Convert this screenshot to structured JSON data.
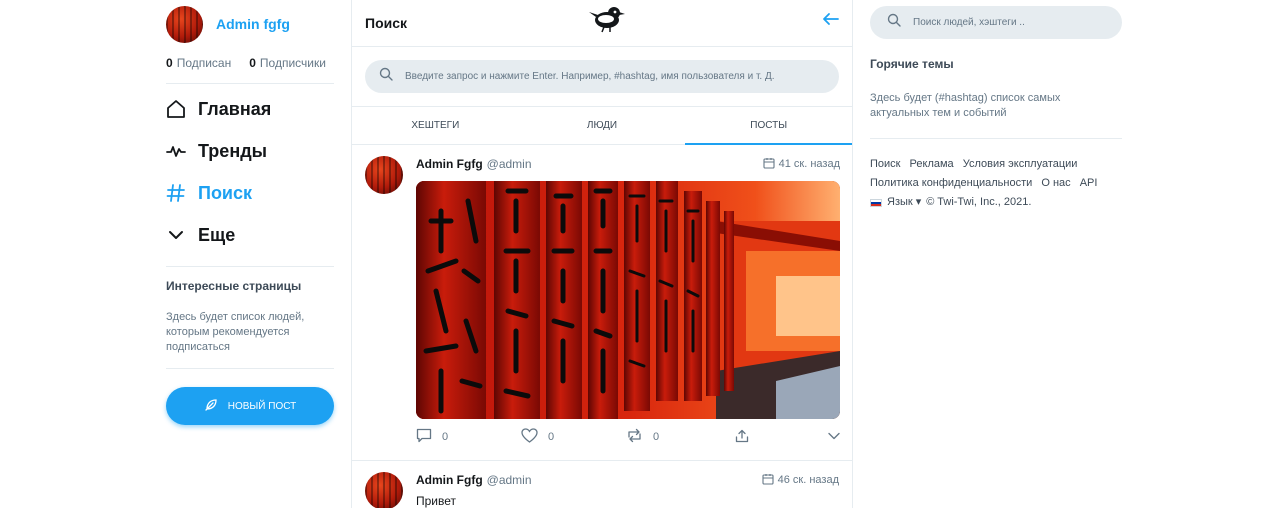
{
  "user": {
    "name": "Admin fgfg",
    "following_count": "0",
    "following_label": "Подписан",
    "followers_count": "0",
    "followers_label": "Подписчики"
  },
  "nav": [
    {
      "label": "Главная",
      "icon": "home-icon"
    },
    {
      "label": "Тренды",
      "icon": "activity-icon"
    },
    {
      "label": "Поиск",
      "icon": "hashtag-icon"
    },
    {
      "label": "Еще",
      "icon": "chevron-down-icon"
    }
  ],
  "interesting": {
    "title": "Интересные страницы",
    "text": "Здесь будет список людей, которым рекомендуется подписаться"
  },
  "new_post_label": "Новый пост",
  "main": {
    "title": "Поиск",
    "search_placeholder": "Введите запрос и нажмите Enter. Например, #hashtag, имя пользователя и т. Д.",
    "tabs": [
      "Хештеги",
      "Люди",
      "Посты"
    ],
    "active_tab": 2
  },
  "posts": [
    {
      "author": "Admin Fgfg",
      "handle": "@admin",
      "time": "41 ск. назад",
      "comments": "0",
      "likes": "0",
      "reposts": "0"
    },
    {
      "author": "Admin Fgfg",
      "handle": "@admin",
      "time": "46 ск. назад",
      "text": "Привет"
    }
  ],
  "right": {
    "search_placeholder": "Поиск людей, хэштеги ..",
    "hot_title": "Горячие темы",
    "hot_text": "Здесь будет (#hashtag) список самых актуальных тем и событий",
    "footer_links": [
      "Поиск",
      "Реклама",
      "Условия эксплуатации",
      "Политика конфиденциальности",
      "О нас",
      "API"
    ],
    "lang_label": "Язык",
    "copyright": "© Twi-Twi, Inc., 2021."
  },
  "colors": {
    "accent": "#1da1f2",
    "muted": "#657786",
    "border": "#e6ecf0"
  }
}
